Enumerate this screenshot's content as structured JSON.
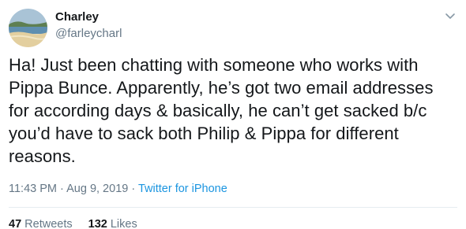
{
  "author": {
    "name": "Charley",
    "handle": "@farleycharl"
  },
  "tweet": {
    "text": "Ha! Just been chatting with someone who works with\nPippa Bunce. Apparently, he’s got two email addresses\nfor according days & basically, he can’t get sacked b/c\nyou’d have to sack both Philip & Pippa for different\nreasons.",
    "time": "11:43 PM",
    "date": "Aug 9, 2019",
    "separator": "·",
    "source": "Twitter for iPhone"
  },
  "stats": {
    "retweets_count": "47",
    "retweets_label": "Retweets",
    "likes_count": "132",
    "likes_label": "Likes"
  },
  "colors": {
    "text": "#14171a",
    "secondary": "#657786",
    "link": "#1b95e0"
  },
  "icons": {
    "caret": "chevron-down-icon",
    "avatar": "beach-photo"
  }
}
